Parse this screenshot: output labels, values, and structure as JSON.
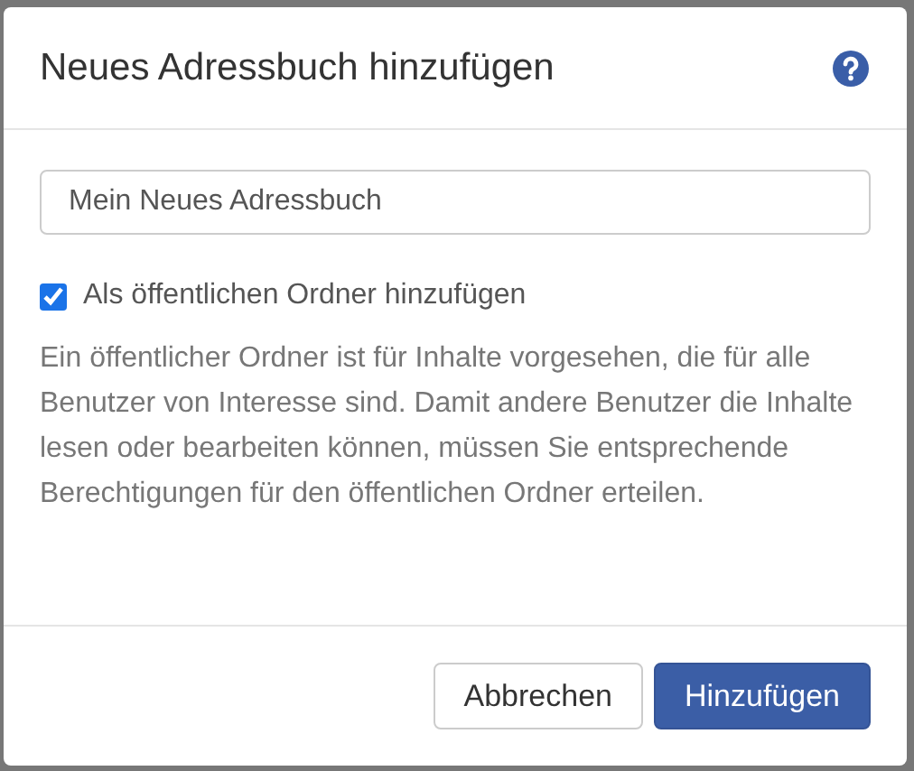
{
  "dialog": {
    "title": "Neues Adressbuch hinzufügen",
    "name_field": {
      "value": "Mein Neues Adressbuch"
    },
    "public_checkbox": {
      "label": "Als öffentlichen Ordner hinzufügen",
      "checked": true
    },
    "description": "Ein öffentlicher Ordner ist für Inhalte vorgesehen, die für alle Benutzer von Interesse sind. Damit andere Benutzer die Inhalte lesen oder bearbeiten können, müssen Sie entsprechende Berechtigungen für den öffentlichen Ordner erteilen.",
    "buttons": [
      {
        "label": "Abbrechen",
        "kind": "secondary"
      },
      {
        "label": "Hinzufügen",
        "kind": "primary"
      }
    ]
  }
}
